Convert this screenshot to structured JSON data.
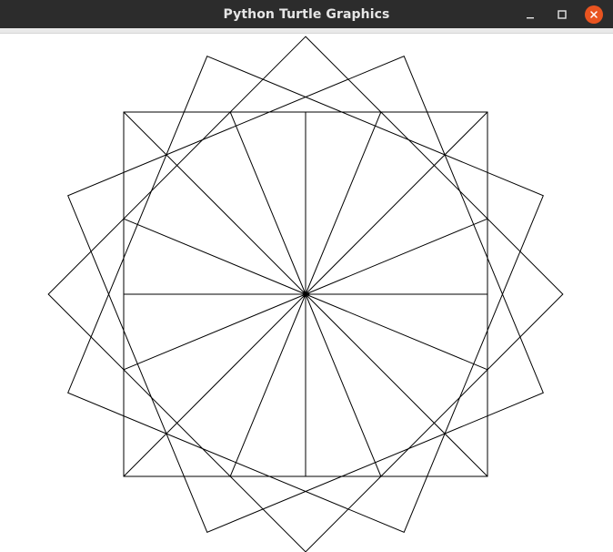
{
  "window": {
    "title": "Python Turtle Graphics"
  },
  "controls": {
    "minimize_icon": "minimize-icon",
    "maximize_icon": "maximize-icon",
    "close_icon": "close-icon"
  },
  "colors": {
    "titlebar": "#2c2c2c",
    "title_text": "#e6e6e6",
    "close_button": "#e95420",
    "canvas_background": "#ffffff",
    "pen": "#000000"
  },
  "drawing": {
    "shape": "square",
    "square_count": 4,
    "rotation_step_degrees": 22.5,
    "spoke_count": 16
  }
}
